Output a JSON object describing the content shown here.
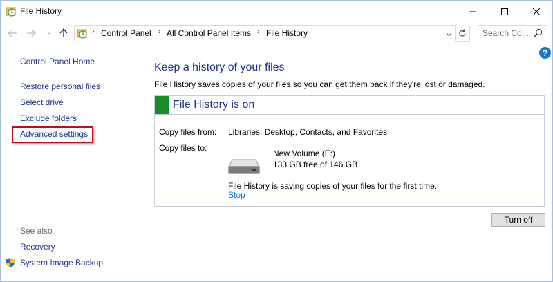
{
  "window": {
    "title": "File History",
    "controls": [
      "minimize",
      "maximize",
      "close"
    ]
  },
  "navigation": {
    "breadcrumbs": [
      "Control Panel",
      "All Control Panel Items",
      "File History"
    ],
    "search_placeholder": "Search Co..."
  },
  "sidebar": {
    "home": "Control Panel Home",
    "items": [
      "Restore personal files",
      "Select drive",
      "Exclude folders",
      "Advanced settings"
    ],
    "highlighted_item": "Advanced settings",
    "see_also_label": "See also",
    "see_also": [
      "Recovery",
      "System Image Backup"
    ]
  },
  "main": {
    "heading": "Keep a history of your files",
    "description": "File History saves copies of your files so you can get them back if they're lost or damaged.",
    "status_title": "File History is on",
    "copy_from_label": "Copy files from:",
    "copy_from_value": "Libraries, Desktop, Contacts, and Favorites",
    "copy_to_label": "Copy files to:",
    "drive_name": "New Volume (E:)",
    "drive_space": "133 GB free of 146 GB",
    "progress_message": "File History is saving copies of your files for the first time.",
    "stop_link": "Stop",
    "turn_off_button": "Turn off"
  },
  "colors": {
    "link": "#1e3287",
    "status_on": "#1a8a2a",
    "highlight_border": "#b5121b",
    "accent_link": "#1a73c8"
  },
  "icons": [
    "file-history-icon",
    "back-arrow-icon",
    "forward-arrow-icon",
    "recent-dropdown-icon",
    "up-arrow-icon",
    "refresh-icon",
    "search-icon",
    "help-icon",
    "shield-icon",
    "drive-icon"
  ]
}
